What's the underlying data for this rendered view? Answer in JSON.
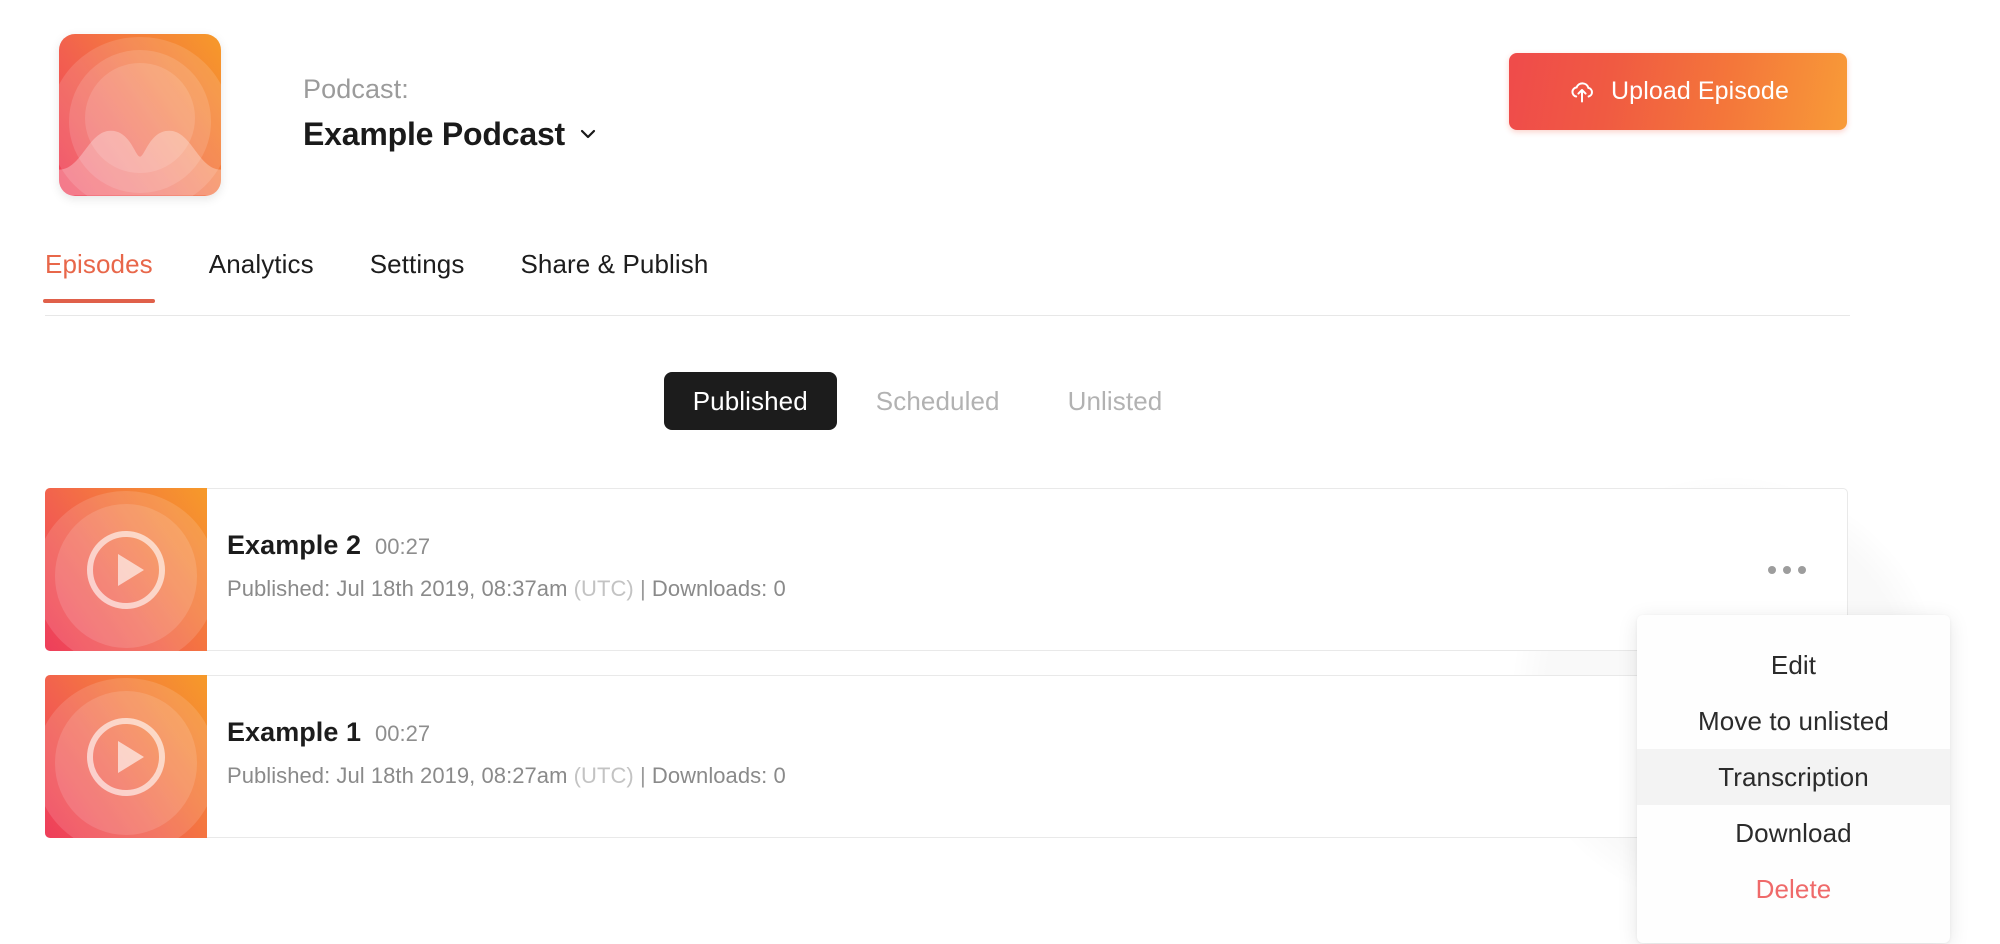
{
  "header": {
    "kicker": "Podcast:",
    "podcast_name": "Example Podcast",
    "chevron_icon": "chevron-down-icon",
    "artwork_icon": "podcast-artwork",
    "upload_button": {
      "label": "Upload Episode",
      "icon": "cloud-upload-icon",
      "gradient_from": "#ef4b4b",
      "gradient_to": "#f89b38"
    }
  },
  "tabs": {
    "items": [
      {
        "label": "Episodes",
        "active": true
      },
      {
        "label": "Analytics",
        "active": false
      },
      {
        "label": "Settings",
        "active": false
      },
      {
        "label": "Share & Publish",
        "active": false
      }
    ],
    "active_color": "#e8674a",
    "underline_color": "#e0604a"
  },
  "filters": {
    "items": [
      {
        "label": "Published",
        "active": true
      },
      {
        "label": "Scheduled",
        "active": false
      },
      {
        "label": "Unlisted",
        "active": false
      }
    ],
    "active_bg": "#1c1c1c",
    "inactive_color": "#b2b2b2"
  },
  "episodes": [
    {
      "title": "Example 2",
      "duration": "00:27",
      "published_label": "Published:",
      "published_date": "Jul 18th 2019, 08:37am",
      "timezone": "(UTC)",
      "separator": "|",
      "downloads_label": "Downloads:",
      "downloads_count": "0",
      "thumb_icon": "play-circle-icon",
      "menu_icon": "kebab-menu-icon"
    },
    {
      "title": "Example 1",
      "duration": "00:27",
      "published_label": "Published:",
      "published_date": "Jul 18th 2019, 08:27am",
      "timezone": "(UTC)",
      "separator": "|",
      "downloads_label": "Downloads:",
      "downloads_count": "0",
      "thumb_icon": "play-circle-icon",
      "menu_icon": "kebab-menu-icon"
    }
  ],
  "dropdown": {
    "open": true,
    "items": [
      {
        "label": "Edit",
        "hovered": false,
        "danger": false
      },
      {
        "label": "Move to unlisted",
        "hovered": false,
        "danger": false
      },
      {
        "label": "Transcription",
        "hovered": true,
        "danger": false
      },
      {
        "label": "Download",
        "hovered": false,
        "danger": false
      },
      {
        "label": "Delete",
        "hovered": false,
        "danger": true
      }
    ],
    "danger_color": "#ef6a6a",
    "hover_bg": "#f3f3f3"
  }
}
